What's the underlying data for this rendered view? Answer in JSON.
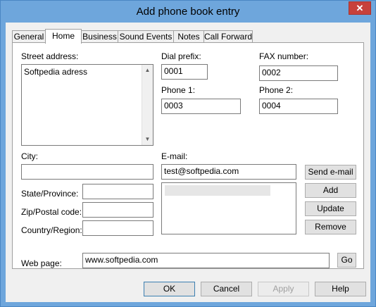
{
  "window": {
    "title": "Add phone book entry",
    "close_label": "✕"
  },
  "tabs": [
    {
      "label": "General"
    },
    {
      "label": "Home"
    },
    {
      "label": "Business"
    },
    {
      "label": "Sound Events"
    },
    {
      "label": "Notes"
    },
    {
      "label": "Call Forward"
    }
  ],
  "form": {
    "street_label": "Street address:",
    "street_value": "Softpedia adress",
    "dial_prefix_label": "Dial prefix:",
    "dial_prefix_value": "0001",
    "fax_label": "FAX number:",
    "fax_value": "0002",
    "phone1_label": "Phone 1:",
    "phone1_value": "0003",
    "phone2_label": "Phone 2:",
    "phone2_value": "0004",
    "city_label": "City:",
    "city_value": "",
    "email_label": "E-mail:",
    "email_value": "test@softpedia.com",
    "state_label": "State/Province:",
    "state_value": "",
    "zip_label": "Zip/Postal code:",
    "zip_value": "",
    "country_label": "Country/Region:",
    "country_value": "",
    "web_label": "Web page:",
    "web_value": "www.softpedia.com"
  },
  "email_buttons": {
    "send": "Send e-mail",
    "add": "Add",
    "update": "Update",
    "remove": "Remove"
  },
  "go_label": "Go",
  "footer": {
    "ok": "OK",
    "cancel": "Cancel",
    "apply": "Apply",
    "help": "Help"
  }
}
